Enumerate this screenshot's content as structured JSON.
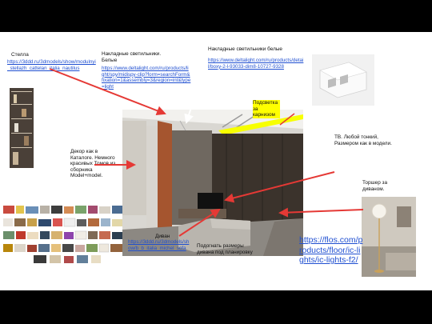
{
  "labels": {
    "shelf_title": "Стелла",
    "shelf_link": "https://3ddd.ru/3dmodels/show/modulnyi_stellazh_cattelan_italia_nautilus",
    "lights_white_title": "Накладные светильники. Белые",
    "lights_white_link": "https://www.deltalight.com/ru/products/light/spy/midispy-clip?form=searchForm&fixation=1&assembly=3&region=int&type=light",
    "lights_white2_title": "Накладные светильники белые",
    "lights_white2_link": "https://www.deltalight.com/ru/products/detail/boxy-2-l-93033-dim8-10727-9328",
    "cornice_light": "Подсветка за карнизом",
    "tv_note": "ТВ. Любой тонкий, Размером как в модели.",
    "decor_note": "Декор как в Каталоге. Немного красивых Томов из сборника Model+model.",
    "floor_lamp_note": "Торшер за диваном.",
    "sofa_title": "Диван",
    "sofa_link": "https://3ddd.ru/3dmodels/show/b_b_italia_michel_sofa",
    "sofa_note": "Подогнать размеры дивана под планировку",
    "flos_link": "https://flos.com/products/floor/ic-lights/ic-lights-f2/"
  },
  "colors": {
    "link": "#1f4fd1",
    "highlight": "#ffff00",
    "arrow": "#e53935",
    "arrow_white": "#ffffff",
    "cornice": "#f7ff00",
    "wall_orange": "#a5552f",
    "wall_dark": "#3b332c"
  }
}
